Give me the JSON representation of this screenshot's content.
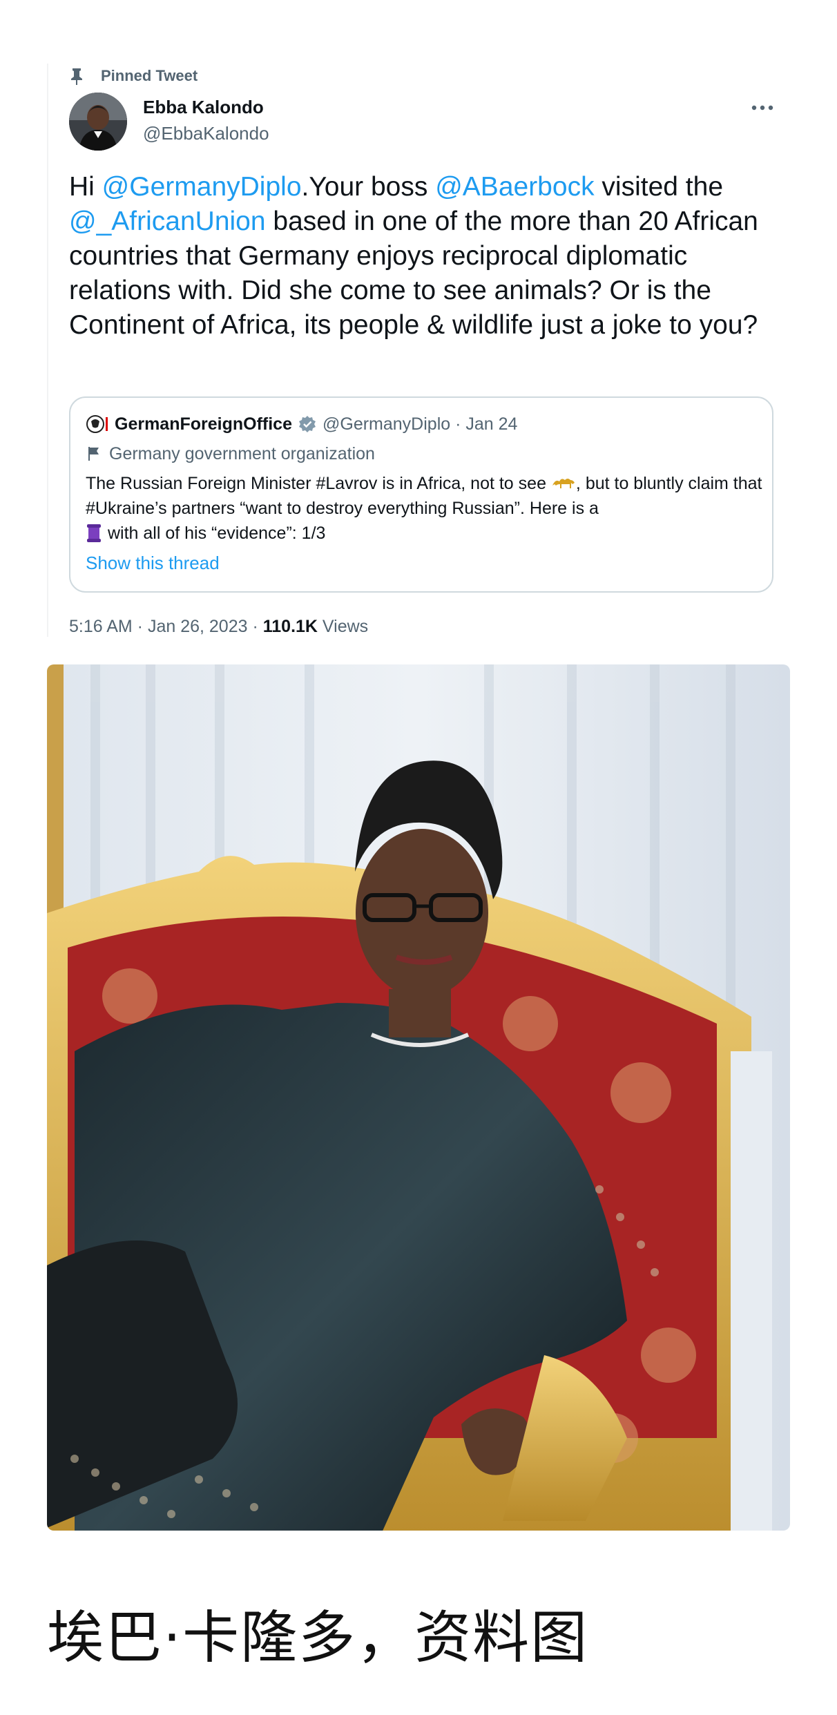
{
  "tweet": {
    "pinned_label": "Pinned Tweet",
    "author_name": "Ebba Kalondo",
    "author_handle": "@EbbaKalondo",
    "text_parts": {
      "p1": "Hi ",
      "m1": "@GermanyDiplo",
      "p2": ".Your boss ",
      "m2": "@ABaerbock",
      "p3": " visited the ",
      "m3": "@_AfricanUnion",
      "p4": " based in one of the more than 20 African countries that Germany enjoys reciprocal diplomatic relations with. Did she come to see animals? Or is the Continent of Africa,  its people & wildlife just a joke to you?"
    },
    "timestamp": "5:16 AM · Jan 26, 2023 · ",
    "views_count": "110.1K",
    "views_label": " Views",
    "icons": [
      "pin-icon",
      "more-icon"
    ]
  },
  "quote": {
    "name": "GermanForeignOffice",
    "handle_date": "@GermanyDiplo · Jan 24",
    "org_label": "Germany government organization",
    "body_part1": "The Russian Foreign Minister #Lavrov is in Africa, not to see ",
    "body_part2": ", but to bluntly claim that #Ukraine’s partners “want to destroy everything Russian”. Here is a ",
    "body_part3": "with all of his “evidence”: 1/3",
    "show_thread": "Show this thread",
    "icons": [
      "flag-icon",
      "verified-icon",
      "flag-org-icon",
      "camel-icon",
      "scroll-icon"
    ]
  },
  "photo": {
    "subject": "woman-in-black-dress-on-gilded-red-throne-chair"
  },
  "caption": "埃巴·卡隆多，资料图",
  "colors": {
    "link": "#1d9bf0",
    "text": "#0f1419",
    "muted": "#536471",
    "border": "#cfd9de"
  }
}
